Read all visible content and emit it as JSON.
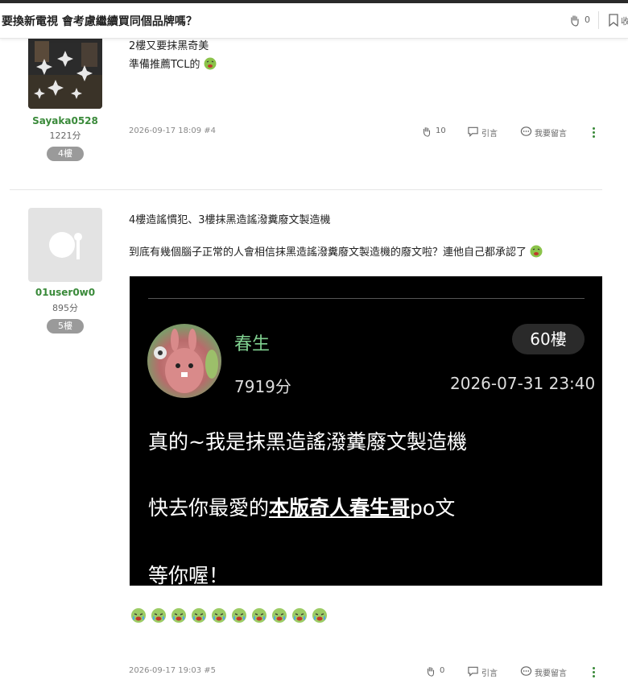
{
  "header": {
    "title": "要換新電視 會考慮繼續買同個品牌嗎？",
    "clap_count": "0",
    "save_label": "收"
  },
  "post4": {
    "username": "Sayaka0528",
    "score": "1221分",
    "floor": "4樓",
    "lines": [
      "2樓又要抹黑奇美",
      "準備推薦TCL的"
    ],
    "date": "2026-09-17 18:09 #4",
    "clap_count": "10",
    "quote_label": "引言",
    "reply_label": "我要留言"
  },
  "post5": {
    "username": "01user0w0",
    "score": "895分",
    "floor": "5樓",
    "lines": [
      "4樓造謠慣犯、3樓抹黑造謠潑糞廢文製造機",
      "到底有幾個腦子正常的人會相信抹黑造謠潑糞廢文製造機的廢文啦？連他自己都承認了"
    ],
    "quote": {
      "name": "春生",
      "floor": "60樓",
      "score": "7919分",
      "date": "2026-07-31 23:40",
      "line1": "真的~我是抹黑造謠潑糞廢文製造機",
      "line2_pre": "快去你最愛的",
      "line2_link": "本版奇人春生哥",
      "line2_post": "po文",
      "line3": "等你喔！"
    },
    "date": "2026-09-17 19:03 #5",
    "clap_count": "0",
    "quote_label": "引言",
    "reply_label": "我要留言"
  },
  "colors": {
    "username": "#3a8a3a",
    "badge": "#9a9a9a",
    "quote_bg": "#000000",
    "quote_name": "#7fcf8f"
  },
  "icons": [
    "clap-icon",
    "bookmark-icon",
    "quote-icon",
    "comment-icon",
    "more-icon",
    "vomit-emoji-icon",
    "cry-emoji-icon"
  ]
}
